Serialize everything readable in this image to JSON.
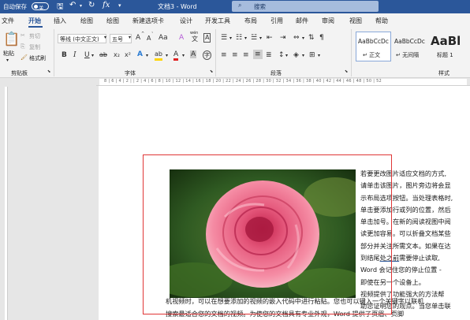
{
  "titlebar": {
    "autosave_label": "自动保存",
    "autosave_state": "关",
    "doc_title": "文档3 - Word",
    "search_placeholder": "搜索"
  },
  "tabs": [
    "文件",
    "开始",
    "插入",
    "绘图",
    "绘图",
    "新建选项卡",
    "设计",
    "开发工具",
    "布局",
    "引用",
    "邮件",
    "审阅",
    "视图",
    "帮助"
  ],
  "active_tab": "开始",
  "clipboard": {
    "paste": "粘贴",
    "cut": "剪切",
    "copy": "复制",
    "format_painter": "格式刷",
    "group_label": "剪贴板"
  },
  "font": {
    "name": "等线 (中文正文)",
    "size": "五号",
    "grow": "A",
    "shrink": "A",
    "aa": "Aa",
    "clear": "A",
    "wen": "wén",
    "border_a": "A",
    "bold": "B",
    "italic": "I",
    "underline": "U",
    "strike": "ab",
    "sub": "x₂",
    "sup": "x²",
    "effects": "A",
    "highlight": "ab",
    "color": "A",
    "shade": "A",
    "circle": "字",
    "group_label": "字体"
  },
  "paragraph": {
    "group_label": "段落"
  },
  "styles": {
    "items": [
      {
        "preview": "AaBbCcDc",
        "name": "↵ 正文"
      },
      {
        "preview": "AaBbCcDc",
        "name": "↵ 无间隔"
      },
      {
        "preview": "AaBl",
        "name": "标题 1"
      }
    ],
    "group_label": "样式"
  },
  "ruler": {
    "marks": "8 | 6 | 4 | 2 |   | 2 | 4 | 6 | 8 | 10 | 12 | 14 | 16 | 18 | 20 | 22 | 24 | 26 | 28 | 30 | 32 | 34 | 36 | 38 | 40 | 42 | 44 | 46 | 48 | 50 | 52"
  },
  "document": {
    "right_lines": [
      "若要更改图片适应文档的方式,",
      "请单击该图片，图片旁边将会显",
      "示布局选项按钮。当处理表格时,",
      "单击要添加行或列的位置，然后",
      "单击加号。在新的阅读视图中阅",
      "读更加容易。可以折叠文档某些",
      "部分并关注所需文本。如果在达",
      "到结尾处之前需要停止读取,",
      "Word 会记住您的停止位置 -",
      "即使在另一个设备上。",
      "视频提供了功能强大的方法帮",
      "助您证明您的观点。当您单击联"
    ],
    "underlined_word": "处之前",
    "bottom_line": "机视频时，可以在想要添加的视频的嵌入代码中进行粘贴。您也可以键入一个关键字以联机",
    "bottom_line2": "搜索最适合您的文档的视频。为使您的文档具有专业外观，Word 提供了页眉、页脚"
  }
}
